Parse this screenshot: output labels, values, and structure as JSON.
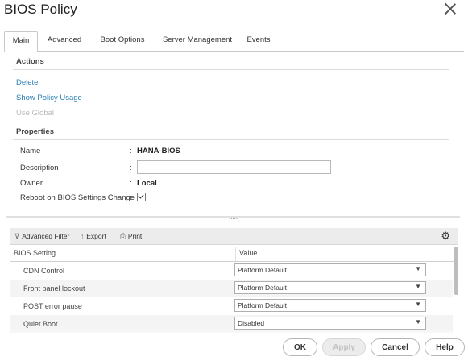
{
  "window": {
    "title": "BIOS Policy"
  },
  "tabs": [
    {
      "label": "Main"
    },
    {
      "label": "Advanced"
    },
    {
      "label": "Boot Options"
    },
    {
      "label": "Server Management"
    },
    {
      "label": "Events"
    }
  ],
  "actions": {
    "header": "Actions",
    "delete": "Delete",
    "show_usage": "Show Policy Usage",
    "use_global": "Use Global"
  },
  "properties": {
    "header": "Properties",
    "name_label": "Name",
    "name_value": "HANA-BIOS",
    "description_label": "Description",
    "description_value": "",
    "owner_label": "Owner",
    "owner_value": "Local",
    "reboot_label": "Reboot on BIOS Settings Change",
    "reboot_checked": true,
    "colon": ":"
  },
  "splitter": {
    "grip": "....."
  },
  "toolbar": {
    "filter": "Advanced Filter",
    "export": "Export",
    "print": "Print",
    "filter_icon": "filter-icon",
    "export_icon": "export-icon",
    "print_icon": "print-icon",
    "settings_icon": "gear-icon"
  },
  "table": {
    "columns": [
      "BIOS Setting",
      "Value"
    ],
    "rows": [
      {
        "setting": "CDN Control",
        "value": "Platform Default"
      },
      {
        "setting": "Front panel lockout",
        "value": "Platform Default"
      },
      {
        "setting": "POST error pause",
        "value": "Platform Default"
      },
      {
        "setting": "Quiet Boot",
        "value": "Disabled"
      }
    ]
  },
  "buttons": {
    "ok": "OK",
    "apply": "Apply",
    "cancel": "Cancel",
    "help": "Help"
  },
  "colors": {
    "link": "#2b7fb8",
    "disabled": "#b9b9b9"
  }
}
